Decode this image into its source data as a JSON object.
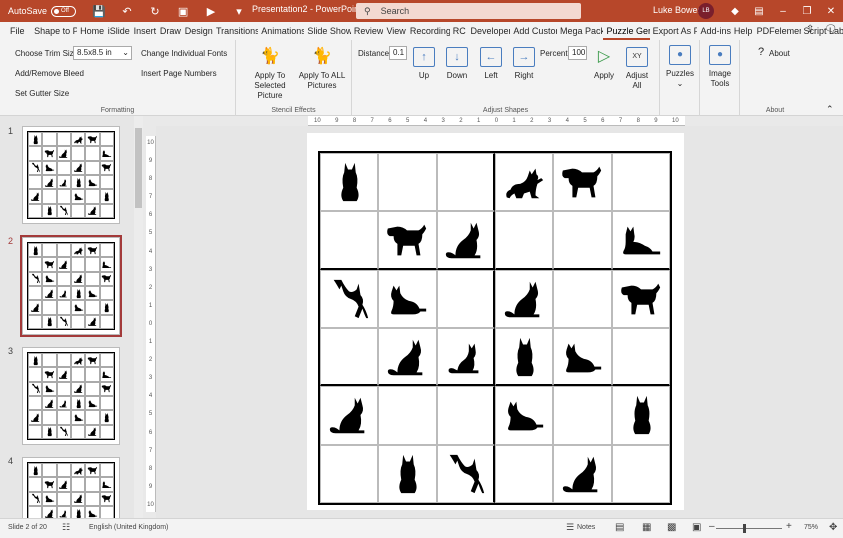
{
  "titlebar": {
    "autosave_label": "AutoSave",
    "autosave_state": "Off",
    "doc_title": "Presentation2  -  PowerPoint",
    "search_placeholder": "Search",
    "user_name": "Luke Bowes",
    "user_initials": "LB",
    "accent_color": "#b7472a"
  },
  "tabs": [
    "File",
    "Shape to P",
    "Home",
    "iSlide",
    "Insert",
    "Draw",
    "Design",
    "Transitions",
    "Animations",
    "Slide Show",
    "Review",
    "View",
    "Recording",
    "RC",
    "Developer",
    "Add Custor",
    "Mega Pack",
    "Puzzle Ger",
    "Export As F",
    "Add-ins",
    "Help",
    "PDFelemer",
    "Script Lab"
  ],
  "active_tab": "Puzzle Ger",
  "ribbon": {
    "formatting": {
      "label": "Formatting",
      "choose_trim_size": "Choose Trim Size",
      "trim_value": "8.5x8.5 in",
      "change_fonts": "Change Individual Fonts",
      "add_remove_bleed": "Add/Remove Bleed",
      "insert_page_numbers": "Insert Page Numbers",
      "set_gutter_size": "Set Gutter Size"
    },
    "stencil": {
      "label": "Stencil Effects",
      "apply_selected": "Apply To Selected Picture",
      "apply_all": "Apply To ALL Pictures"
    },
    "adjust": {
      "label": "Adjust Shapes",
      "distance_label": "Distance",
      "distance_value": "0.1",
      "up": "Up",
      "down": "Down",
      "left": "Left",
      "right": "Right",
      "percent_label": "Percent",
      "percent_value": "100",
      "apply": "Apply",
      "adjust_all": "Adjust All"
    },
    "puzzles": "Puzzles",
    "image_tools": "Image Tools",
    "about_group": {
      "label": "About",
      "about": "About"
    }
  },
  "slides": [
    {
      "num": "1",
      "selected": false
    },
    {
      "num": "2",
      "selected": true
    },
    {
      "num": "3",
      "selected": false
    },
    {
      "num": "4",
      "selected": false
    }
  ],
  "hruler_ticks": [
    "10",
    "9",
    "8",
    "7",
    "6",
    "5",
    "4",
    "3",
    "2",
    "1",
    "0",
    "1",
    "2",
    "3",
    "4",
    "5",
    "6",
    "7",
    "8",
    "9",
    "10"
  ],
  "vruler_ticks": [
    "10",
    "9",
    "8",
    "7",
    "6",
    "5",
    "4",
    "3",
    "2",
    "1",
    "0",
    "1",
    "2",
    "3",
    "4",
    "5",
    "6",
    "7",
    "8",
    "9",
    "10"
  ],
  "puzzle_grid": [
    [
      "cat-sitting",
      "",
      "",
      "cat-playing",
      "dog",
      ""
    ],
    [
      "",
      "dog",
      "cat-sitting-side",
      "",
      "",
      "cat-lying"
    ],
    [
      "cat-standing",
      "cat-crouching",
      "",
      "cat-sitting-side",
      "",
      "dog"
    ],
    [
      "",
      "cat-sitting-side",
      "cat-sitting-small",
      "cat-sitting",
      "cat-crouching",
      ""
    ],
    [
      "cat-sitting-side",
      "",
      "",
      "cat-crouching",
      "",
      "cat-sitting"
    ],
    [
      "",
      "cat-sitting",
      "cat-standing",
      "",
      "cat-sitting-side",
      ""
    ]
  ],
  "status": {
    "slide_info": "Slide 2 of 20",
    "language": "English (United Kingdom)",
    "notes": "Notes",
    "zoom": "75%"
  }
}
